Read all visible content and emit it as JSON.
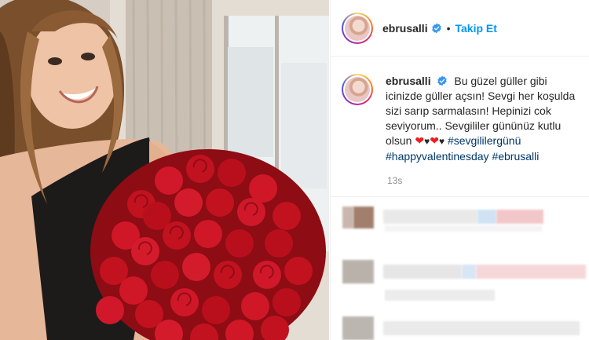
{
  "post": {
    "username": "ebrusalli",
    "follow_label": "Takip Et",
    "separator": "•",
    "caption_line1": "Bu güzel güller gibi icinizde güller açsın! Sevgi her koşulda sizi sarıp sarmalasın! Hepinizi cok seviyorum.. Sevgililer gününüz kutlu olsun",
    "hashtags": [
      "#sevgililergünü",
      "#happyvalentinesday",
      "#ebrusalli"
    ],
    "timestamp": "13s"
  },
  "icons": {
    "verified": "verified-badge-icon",
    "heart": "red-heart-emoji",
    "black_heart": "black-heart-emoji"
  },
  "colors": {
    "follow_blue": "#0095f6",
    "hashtag": "#00376b",
    "muted": "#8e8e8e",
    "verified_blue": "#3897f0"
  }
}
